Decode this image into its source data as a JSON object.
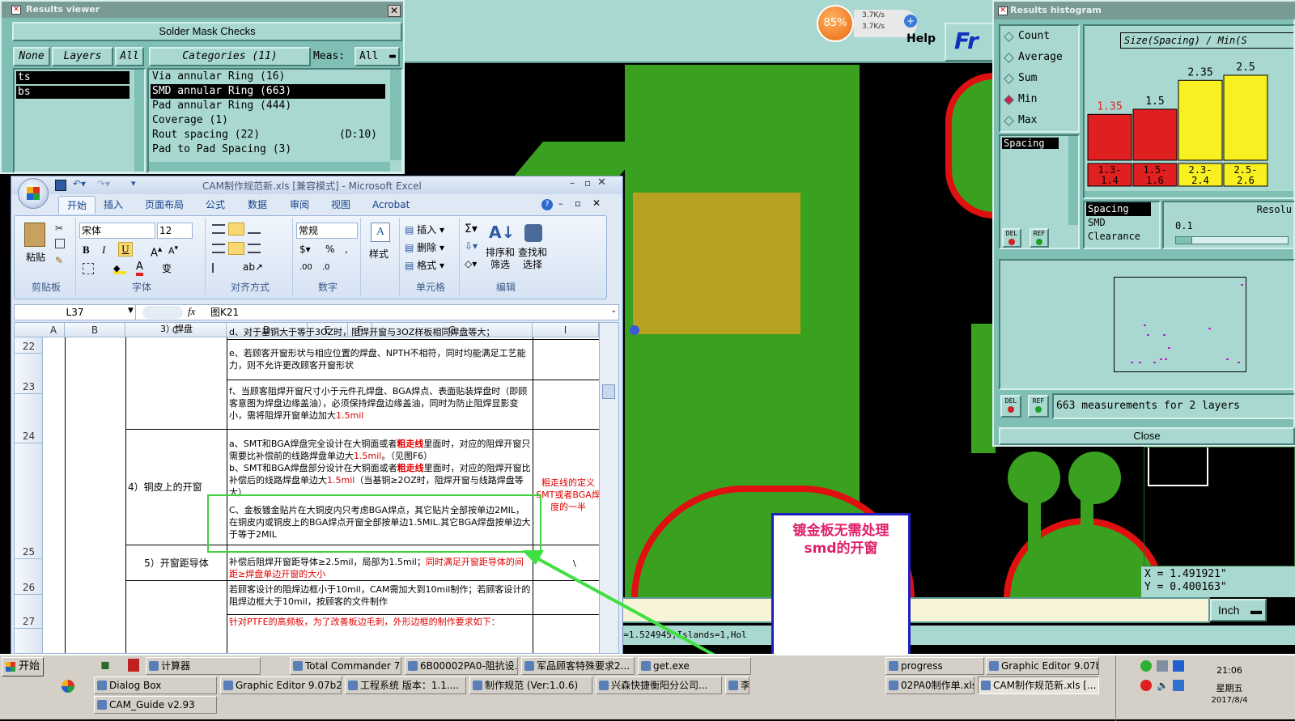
{
  "results_viewer": {
    "title": "Results viewer",
    "header": "Solder Mask Checks",
    "none_btn": "None",
    "layers_btn": "Layers",
    "all_btn": "All",
    "categories_btn": "Categories (11)",
    "meas_label": "Meas:",
    "meas_value": "All",
    "layers": [
      "ts",
      "bs"
    ],
    "categories": [
      {
        "label": "Via annular Ring (16)",
        "extra": ""
      },
      {
        "label": "SMD annular Ring (663)",
        "extra": ""
      },
      {
        "label": "Pad annular Ring (444)",
        "extra": ""
      },
      {
        "label": "Coverage (1)",
        "extra": ""
      },
      {
        "label": "Rout spacing (22)",
        "extra": "(D:10)"
      },
      {
        "label": "Pad to Pad Spacing (3)",
        "extra": ""
      }
    ]
  },
  "network": {
    "percent": "85%",
    "up": "3.7K/s",
    "down": "3.7K/s"
  },
  "help_label": "Help",
  "logo_text": "Fr",
  "histogram": {
    "title": "Results histogram",
    "options": [
      {
        "label": "Count",
        "selected": false
      },
      {
        "label": "Average",
        "selected": false
      },
      {
        "label": "Sum",
        "selected": false
      },
      {
        "label": "Min",
        "selected": true
      },
      {
        "label": "Max",
        "selected": false
      }
    ],
    "chart_title": "Size(Spacing) / Min(S",
    "spacing_item": "Spacing",
    "bar_values": [
      "1.35",
      "1.5",
      "2.35",
      "2.5"
    ],
    "bar_ranges": [
      "1.3-\n1.4",
      "1.5-\n1.6",
      "2.3-\n2.4",
      "2.5-\n2.6"
    ],
    "types": [
      "Spacing",
      "SMD",
      "Clearance"
    ],
    "resolution_label": "Resolu",
    "resolution_value": "0.1",
    "del_label": "DEL",
    "ref_label": "REF",
    "measurements": "663 measurements for 2 layers",
    "close_label": "Close"
  },
  "coords": {
    "x": "X = 1.491921\"",
    "y": "Y = 0.400163\""
  },
  "unit": "Inch",
  "status_text": "YC=1.524945,Islands=1,Hol",
  "annotation": "镀金板无需处理smd的开窗",
  "excel": {
    "title": "CAM制作规范新.xls  [兼容模式] - Microsoft Excel",
    "tabs": [
      "开始",
      "插入",
      "页面布局",
      "公式",
      "数据",
      "审阅",
      "视图",
      "Acrobat"
    ],
    "font_name": "宋体",
    "font_size": "12",
    "number_format": "常规",
    "groups": [
      "剪贴板",
      "字体",
      "对齐方式",
      "数字",
      "样式",
      "单元格",
      "编辑"
    ],
    "paste": "粘贴",
    "style_btn": "样式",
    "cells_btns": [
      "插入",
      "删除",
      "格式"
    ],
    "sort_btn": "排序和\n筛选",
    "find_btn": "查找和\n选择",
    "cell_ref": "L37",
    "formula": "图K21",
    "columns": [
      "A",
      "B",
      "C",
      "D",
      "E",
      "F",
      "G",
      "I"
    ],
    "rows": [
      "22",
      "23",
      "24",
      "25",
      "26",
      "27"
    ],
    "row22": "d、对于基铜大于等于3OZ时，阻焊开窗与3OZ样板相同焊盘等大；",
    "row22_c": "3）焊盘",
    "row23": "e、若顾客开窗形状与相应位置的焊盘、NPTH不相符，同时均能满足工艺能力，则不允许更改顾客开窗形状",
    "row24": "f、当顾客阻焊开窗尺寸小于元件孔焊盘、BGA焊点、表面贴装焊盘时（即顾客意图为焊盘边缘盖油），必须保持焊盘边缘盖油，同时为防止阻焊显影变小，需将阻焊开窗单边加大",
    "row24_red": "1.5mil",
    "row25_c": "4）铜皮上的开窗",
    "row25_a1": "a、SMT和BGA焊盘完全设计在大铜面或者",
    "row25_a_bold": "粗走线",
    "row25_a2": "里面时，对应的阻焊开窗只需要比补偿前的线路焊盘单边大",
    "row25_a_red": "1.5mil",
    "row25_a3": "。（见图F6）",
    "row25_b1": "b、SMT和BGA焊盘部分设计在大铜面或者",
    "row25_b2": "里面时，对应的阻焊开窗比补偿后的线路焊盘单边大",
    "row25_b3": "（当基铜≥2OZ时，阻焊开窗与线路焊盘等大）",
    "row25_c_text": "C、金板镀金贴片在大铜皮内只考虑BGA焊点，其它贴片全部按单边2MIL，在铜皮内或铜皮上的BGA焊点开窗全部按单边1.5MIL.其它BGA焊盘按单边大于等于2MIL",
    "row25_note": "粗走线的定义SMT或者BGA焊度的一半",
    "row26_c": "5）开窗距导体",
    "row26_a": "补偿后阻焊开窗距导体≥2.5mil，局部为1.5mil；",
    "row26_red": "同时满足开窗距导体的间距≥焊盘单边开窗的大小",
    "row26_h": "\\",
    "row27": "若顾客设计的阻焊边框小于10mil，CAM需加大到10mil制作；若顾客设计的阻焊边框大于10mil，按顾客的文件制作",
    "row28_red": "针对PTFE的高频板，为了改善板边毛刺，外形边框的制作要求如下："
  },
  "taskbar": {
    "start": "开始",
    "row1": [
      "计算器",
      "Total Commander 7.0...",
      "6B00002PA0-阻抗设...",
      "军品顾客特殊要求2...",
      "get.exe",
      "progress",
      "Graphic Editor 9.07b2..."
    ],
    "row2": [
      "Dialog Box",
      "Graphic Editor 9.07b2 (0...",
      "工程系统  版本：1.1....",
      "制作规范 (Ver:1.0.6)",
      "兴森快捷衡阳分公司...",
      "李",
      "02PA0制作单.xls ...",
      "CAM制作规范新.xls [..."
    ],
    "row3": [
      "CAM_Guide v2.93"
    ],
    "time": "21:06",
    "weekday": "星期五",
    "date": "2017/8/4"
  }
}
